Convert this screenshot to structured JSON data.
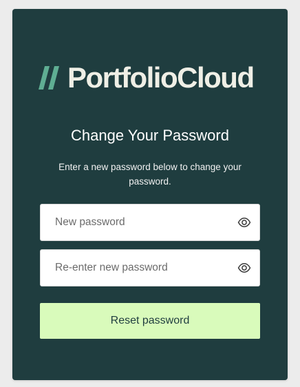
{
  "brand": {
    "name": "PortfolioCloud",
    "logo_icon": "slash-mark-icon",
    "colors": {
      "card_background": "#1f3d3f",
      "logo_mark": "#5fae93",
      "logo_text": "#efefe6",
      "button_background": "#d9fbbb",
      "button_text": "#1f3d3f"
    }
  },
  "form": {
    "title": "Change Your Password",
    "instructions": "Enter a new password below to change your password.",
    "new_password": {
      "placeholder": "New password",
      "value": "",
      "toggle_icon": "eye-icon"
    },
    "confirm_password": {
      "placeholder": "Re-enter new password",
      "value": "",
      "toggle_icon": "eye-icon"
    },
    "submit_label": "Reset password"
  }
}
